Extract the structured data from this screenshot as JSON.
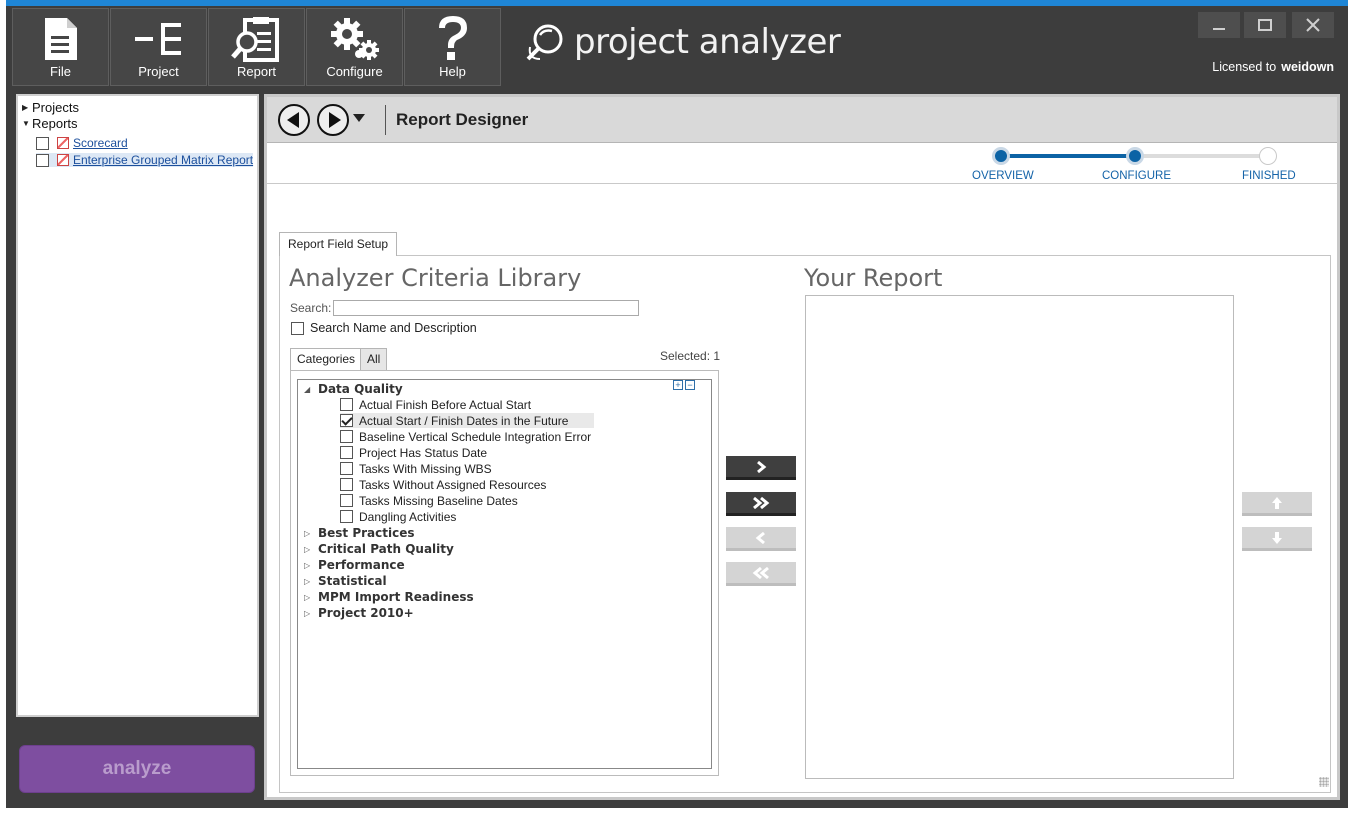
{
  "toolbar": {
    "buttons": [
      {
        "label": "File",
        "icon": "file-icon"
      },
      {
        "label": "Project",
        "icon": "project-hierarchy-icon"
      },
      {
        "label": "Report",
        "icon": "report-clipboard-icon"
      },
      {
        "label": "Configure",
        "icon": "gears-icon"
      },
      {
        "label": "Help",
        "icon": "question-mark-icon"
      }
    ],
    "brand": "project analyzer",
    "license_prefix": "Licensed to",
    "license_user": "weidown"
  },
  "sidebar": {
    "projects_label": "Projects",
    "reports_label": "Reports",
    "reports": [
      {
        "label": "Scorecard",
        "checked": false
      },
      {
        "label": "Enterprise Grouped Matrix Report",
        "checked": false
      }
    ],
    "analyze_label": "analyze"
  },
  "main": {
    "title": "Report Designer",
    "wizard_steps": [
      {
        "label": "OVERVIEW",
        "state": "done"
      },
      {
        "label": "CONFIGURE",
        "state": "current"
      },
      {
        "label": "FINISHED",
        "state": "todo"
      }
    ],
    "tab_label": "Report Field Setup",
    "library": {
      "title": "Analyzer Criteria Library",
      "search_label": "Search:",
      "search_value": "",
      "search_desc_label": "Search Name and Description",
      "subtabs": [
        "Categories",
        "All"
      ],
      "selected_label": "Selected: 1",
      "categories": [
        {
          "label": "Data Quality",
          "expanded": true,
          "items": [
            {
              "label": "Actual Finish Before Actual Start",
              "checked": false
            },
            {
              "label": "Actual Start / Finish Dates in the Future",
              "checked": true
            },
            {
              "label": "Baseline Vertical Schedule Integration Error",
              "checked": false
            },
            {
              "label": "Project Has Status Date",
              "checked": false
            },
            {
              "label": "Tasks With Missing WBS",
              "checked": false
            },
            {
              "label": "Tasks Without Assigned Resources",
              "checked": false
            },
            {
              "label": "Tasks Missing Baseline Dates",
              "checked": false
            },
            {
              "label": "Dangling Activities",
              "checked": false
            }
          ]
        },
        {
          "label": "Best Practices",
          "expanded": false
        },
        {
          "label": "Critical Path Quality",
          "expanded": false
        },
        {
          "label": "Performance",
          "expanded": false
        },
        {
          "label": "Statistical",
          "expanded": false
        },
        {
          "label": "MPM Import Readiness",
          "expanded": false
        },
        {
          "label": "Project 2010+",
          "expanded": false
        }
      ]
    },
    "report": {
      "title": "Your Report",
      "items": []
    }
  },
  "colors": {
    "accent_blue": "#1f86d6",
    "wizard_blue": "#0c63a5",
    "analyze_purple": "#7e4ea0",
    "toolbar_bg": "#3d3d3d"
  }
}
